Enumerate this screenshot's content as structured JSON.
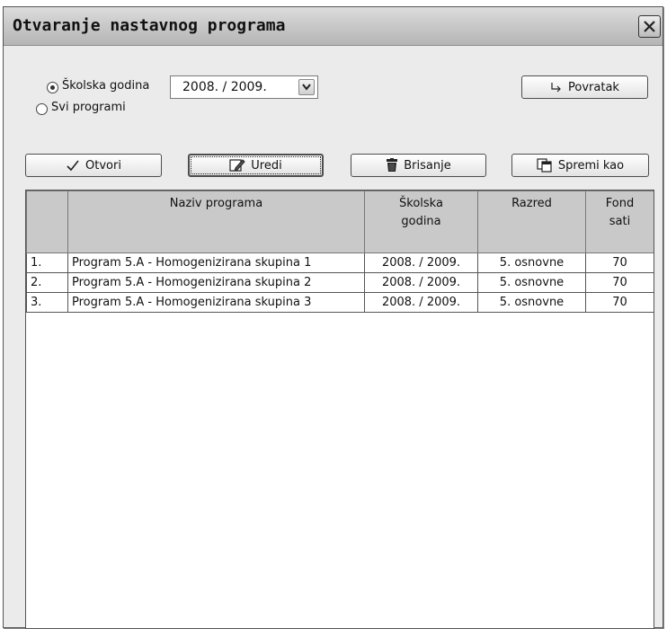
{
  "window": {
    "title": "Otvaranje nastavnog programa"
  },
  "filter": {
    "option_school_year": "Školska godina",
    "option_all": "Svi programi",
    "selected": "school_year",
    "year_value": "2008. / 2009."
  },
  "buttons": {
    "back": "Povratak",
    "open": "Otvori",
    "edit": "Uredi",
    "delete": "Brisanje",
    "save_as": "Spremi kao"
  },
  "table": {
    "headers": {
      "program_name": "Naziv programa",
      "school_year_line1": "Školska",
      "school_year_line2": "godina",
      "grade": "Razred",
      "hours_line1": "Fond",
      "hours_line2": "sati"
    },
    "rows": [
      {
        "num": "1.",
        "name": "Program 5.A - Homogenizirana skupina 1",
        "year": "2008. / 2009.",
        "grade": "5. osnovne",
        "hours": "70"
      },
      {
        "num": "2.",
        "name": "Program 5.A - Homogenizirana skupina 2",
        "year": "2008. / 2009.",
        "grade": "5. osnovne",
        "hours": "70"
      },
      {
        "num": "3.",
        "name": "Program 5.A - Homogenizirana skupina 3",
        "year": "2008. / 2009.",
        "grade": "5. osnovne",
        "hours": "70"
      }
    ]
  }
}
